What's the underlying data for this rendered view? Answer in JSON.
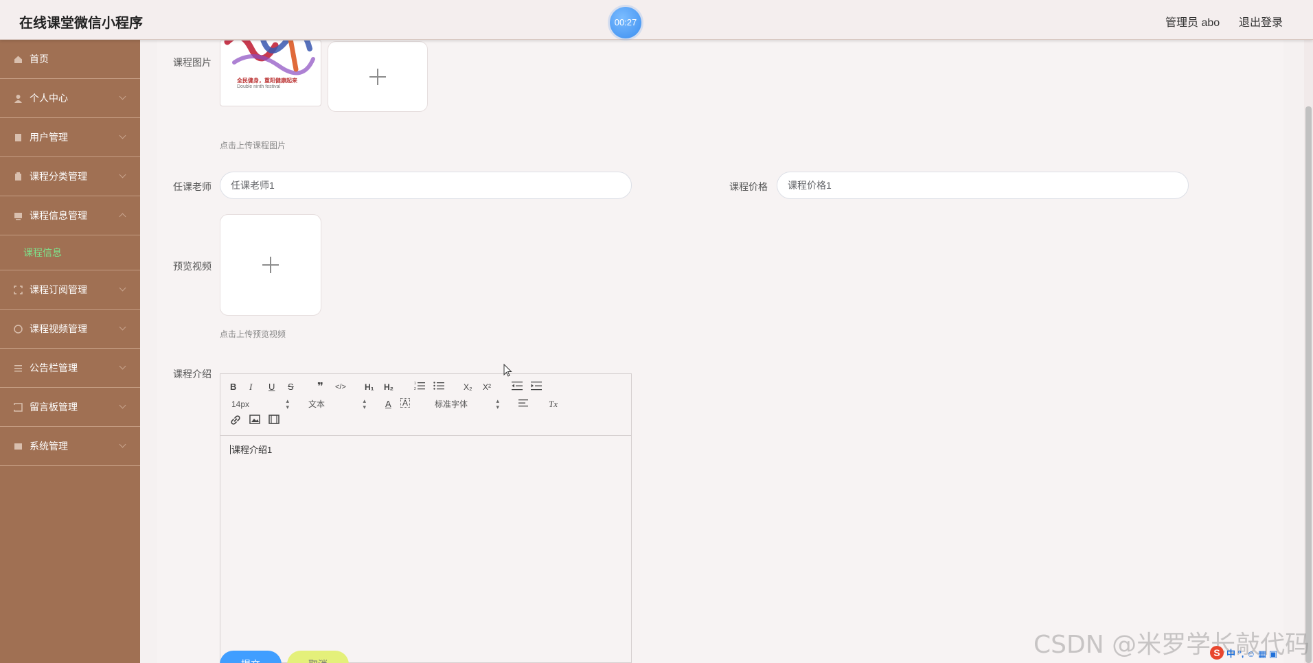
{
  "header": {
    "app_title": "在线课堂微信小程序",
    "timer": "00:27",
    "user": "管理员 abo",
    "logout": "退出登录"
  },
  "sidebar": {
    "items": [
      {
        "label": "首页",
        "icon": "home-icon"
      },
      {
        "label": "个人中心",
        "icon": "user-icon"
      },
      {
        "label": "用户管理",
        "icon": "users-icon"
      },
      {
        "label": "课程分类管理",
        "icon": "category-icon"
      },
      {
        "label": "课程信息管理",
        "icon": "course-icon",
        "expanded": true
      },
      {
        "label": "课程订阅管理",
        "icon": "subscription-icon"
      },
      {
        "label": "课程视频管理",
        "icon": "video-icon"
      },
      {
        "label": "公告栏管理",
        "icon": "notice-icon"
      },
      {
        "label": "留言板管理",
        "icon": "message-icon"
      },
      {
        "label": "系统管理",
        "icon": "system-icon"
      }
    ],
    "submenu_active": "课程信息"
  },
  "form": {
    "course_image": {
      "label": "课程图片",
      "hint": "点击上传课程图片",
      "thumb_caption1": "全民健身，重阳健康起来",
      "thumb_caption2": "Double ninth festival"
    },
    "teacher": {
      "label": "任课老师",
      "value": "任课老师1"
    },
    "price": {
      "label": "课程价格",
      "value": "课程价格1"
    },
    "preview_video": {
      "label": "预览视频",
      "hint": "点击上传预览视频"
    },
    "intro": {
      "label": "课程介绍",
      "content": "课程介绍1",
      "font_size": "14px",
      "paragraph": "文本",
      "font_family": "标准字体"
    },
    "submit": "提交",
    "cancel": "取消"
  },
  "watermark": "CSDN @米罗学长敲代码",
  "ime": {
    "logo": "S",
    "text": "中 °, ☺ ▦ ▣"
  },
  "colors": {
    "sidebar": "#a07053",
    "active_submenu": "#7ee08a",
    "submit": "#409eff",
    "cancel": "#e4f07a"
  }
}
